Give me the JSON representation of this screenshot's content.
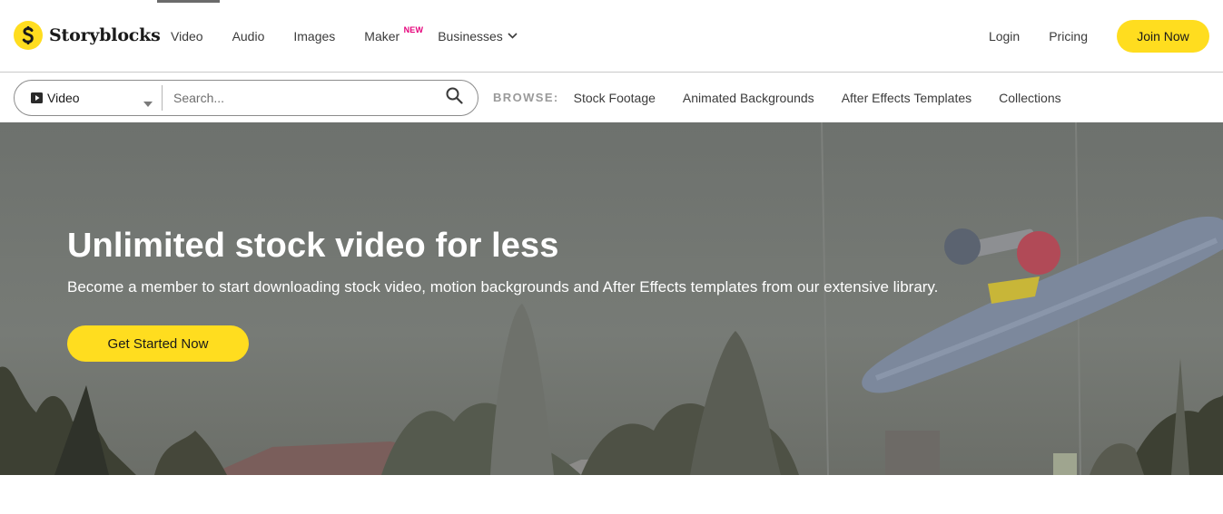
{
  "brand": {
    "name": "Storyblocks",
    "accent_color": "#ffdd1f",
    "logo_icon": "storyblocks-s-icon"
  },
  "nav": {
    "items": [
      {
        "label": "Video"
      },
      {
        "label": "Audio"
      },
      {
        "label": "Images"
      },
      {
        "label": "Maker",
        "badge": "NEW"
      },
      {
        "label": "Businesses",
        "icon": "chevron-down-icon"
      }
    ],
    "login_label": "Login",
    "pricing_label": "Pricing",
    "join_label": "Join Now"
  },
  "search": {
    "type_label": "Video",
    "type_icon": "play-icon",
    "placeholder": "Search...",
    "value": "",
    "search_icon": "magnifier-icon"
  },
  "browse": {
    "label": "BROWSE:",
    "links": [
      "Stock Footage",
      "Animated Backgrounds",
      "After Effects Templates",
      "Collections"
    ]
  },
  "hero": {
    "title": "Unlimited stock video for less",
    "subtitle": "Become a member to start downloading stock video, motion backgrounds and After Effects templates from our extensive library.",
    "cta_label": "Get Started Now"
  }
}
